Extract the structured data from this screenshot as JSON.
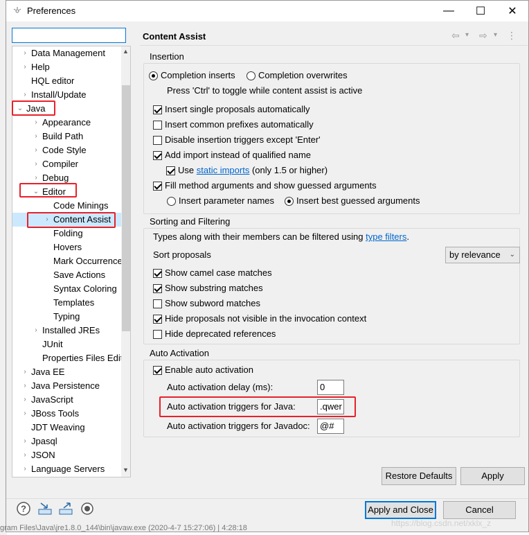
{
  "window": {
    "title": "Preferences",
    "minimize": "—",
    "maximize": "☐",
    "close": "✕"
  },
  "filter": {
    "value": "",
    "placeholder": ""
  },
  "tree": [
    {
      "label": "Data Management",
      "chevron": "›"
    },
    {
      "label": "Help",
      "chevron": "›"
    },
    {
      "label": "HQL editor",
      "chevron": ""
    },
    {
      "label": "Install/Update",
      "chevron": "›"
    },
    {
      "label": "Java",
      "chevron": "⌄"
    },
    {
      "label": "Appearance",
      "chevron": "›"
    },
    {
      "label": "Build Path",
      "chevron": "›"
    },
    {
      "label": "Code Style",
      "chevron": "›"
    },
    {
      "label": "Compiler",
      "chevron": "›"
    },
    {
      "label": "Debug",
      "chevron": "›"
    },
    {
      "label": "Editor",
      "chevron": "⌄"
    },
    {
      "label": "Code Minings",
      "chevron": ""
    },
    {
      "label": "Content Assist",
      "chevron": "›"
    },
    {
      "label": "Folding",
      "chevron": ""
    },
    {
      "label": "Hovers",
      "chevron": ""
    },
    {
      "label": "Mark Occurrences",
      "chevron": ""
    },
    {
      "label": "Save Actions",
      "chevron": ""
    },
    {
      "label": "Syntax Coloring",
      "chevron": ""
    },
    {
      "label": "Templates",
      "chevron": ""
    },
    {
      "label": "Typing",
      "chevron": ""
    },
    {
      "label": "Installed JREs",
      "chevron": "›"
    },
    {
      "label": "JUnit",
      "chevron": ""
    },
    {
      "label": "Properties Files Editor",
      "chevron": ""
    },
    {
      "label": "Java EE",
      "chevron": "›"
    },
    {
      "label": "Java Persistence",
      "chevron": "›"
    },
    {
      "label": "JavaScript",
      "chevron": "›"
    },
    {
      "label": "JBoss Tools",
      "chevron": "›"
    },
    {
      "label": "JDT Weaving",
      "chevron": ""
    },
    {
      "label": "Jpasql",
      "chevron": "›"
    },
    {
      "label": "JSON",
      "chevron": "›"
    },
    {
      "label": "Language Servers",
      "chevron": "›"
    }
  ],
  "page": {
    "title": "Content Assist",
    "nav": {
      "back": "⇦",
      "back_menu": "▾",
      "forward": "⇨",
      "forward_menu": "▾",
      "more": "⋮"
    },
    "insertion": {
      "legend": "Insertion",
      "completion_inserts": "Completion inserts",
      "completion_overwrites": "Completion overwrites",
      "toggle_hint": "Press 'Ctrl' to toggle while content assist is active",
      "insert_single": "Insert single proposals automatically",
      "insert_common": "Insert common prefixes automatically",
      "disable_triggers": "Disable insertion triggers except 'Enter'",
      "add_import": "Add import instead of qualified name",
      "use_static_prefix": "Use",
      "static_imports_link": "static imports",
      "use_static_suffix": "(only 1.5 or higher)",
      "fill_args": "Fill method arguments and show guessed arguments",
      "insert_param_names": "Insert parameter names",
      "insert_best_guessed": "Insert best guessed arguments"
    },
    "sorting": {
      "legend": "Sorting and Filtering",
      "types_text": "Types along with their members can be filtered using",
      "type_filters_link": "type filters",
      "period": ".",
      "sort_label": "Sort proposals",
      "sort_value": "by relevance",
      "camel_case": "Show camel case matches",
      "substring": "Show substring matches",
      "subword": "Show subword matches",
      "hide_invisible": "Hide proposals not visible in the invocation context",
      "hide_deprecated": "Hide deprecated references"
    },
    "auto": {
      "legend": "Auto Activation",
      "enable": "Enable auto activation",
      "delay_label": "Auto activation delay (ms):",
      "delay_value": "0",
      "java_label": "Auto activation triggers for Java:",
      "java_value": ".qwer",
      "javadoc_label": "Auto activation triggers for Javadoc:",
      "javadoc_value": "@#"
    },
    "restore_defaults": "Restore Defaults",
    "apply": "Apply"
  },
  "footer": {
    "apply_and_close": "Apply and Close",
    "cancel": "Cancel",
    "help_icon": "?"
  },
  "background": {
    "watermark": "https://blog.csdn.net/xklx_z",
    "bottom_text": "gram Files\\Java\\jre1.8.0_144\\bin\\javaw.exe (2020-4-7 15:27:06) | 4:28:18"
  },
  "colors": {
    "accent": "#0078d7",
    "highlight": "#e8202a",
    "selection": "#cce8ff"
  }
}
